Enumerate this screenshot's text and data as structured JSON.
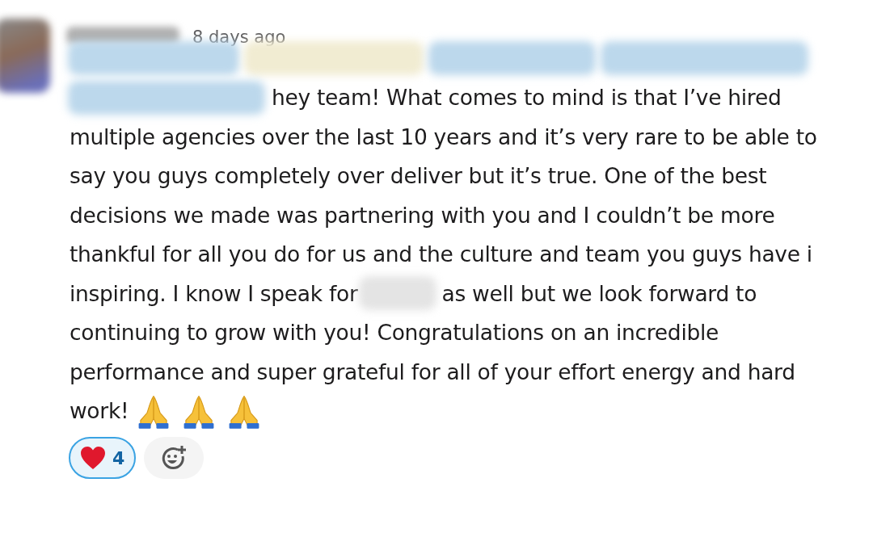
{
  "message": {
    "timestamp": "8 days ago",
    "lines": [
      {
        "parts": [
          {
            "kind": "redacted",
            "color": "#bcd8ec"
          },
          {
            "kind": "redacted",
            "color": "#f1ecd2"
          },
          {
            "kind": "redacted",
            "color": "#bcd8ec"
          },
          {
            "kind": "redacted",
            "color": "#bcd8ec"
          }
        ]
      },
      {
        "parts": [
          {
            "kind": "redacted",
            "color": "#bcd8ec"
          },
          {
            "kind": "text",
            "text": "hey team! What comes to mind is that I’ve hired"
          }
        ]
      },
      {
        "parts": [
          {
            "kind": "text",
            "text": "multiple agencies over the last 10 years and it’s very rare to be able to"
          }
        ]
      },
      {
        "parts": [
          {
            "kind": "text",
            "text": "say you guys completely over deliver but it’s true. One of the best"
          }
        ]
      },
      {
        "parts": [
          {
            "kind": "text",
            "text": "decisions we made was partnering with you and I couldn’t be more"
          }
        ]
      },
      {
        "parts": [
          {
            "kind": "text",
            "text": "thankful for all you do for us and the culture and team you guys have i"
          }
        ]
      },
      {
        "parts": [
          {
            "kind": "text",
            "text": "inspiring. I know I speak for"
          },
          {
            "kind": "redacted",
            "color": "#e4e4e4"
          },
          {
            "kind": "text",
            "text": "as well but we look forward to"
          }
        ]
      },
      {
        "parts": [
          {
            "kind": "text",
            "text": "continuing to grow with you! Congratulations on an incredible"
          }
        ]
      },
      {
        "parts": [
          {
            "kind": "text",
            "text": "performance and super grateful for all of your effort energy and hard"
          }
        ]
      },
      {
        "parts": [
          {
            "kind": "text",
            "text": "work!"
          },
          {
            "kind": "emoji"
          },
          {
            "kind": "emoji"
          },
          {
            "kind": "emoji"
          }
        ]
      }
    ],
    "reactions": [
      {
        "kind": "heart",
        "count": "4",
        "selected": true
      },
      {
        "kind": "add"
      }
    ]
  }
}
